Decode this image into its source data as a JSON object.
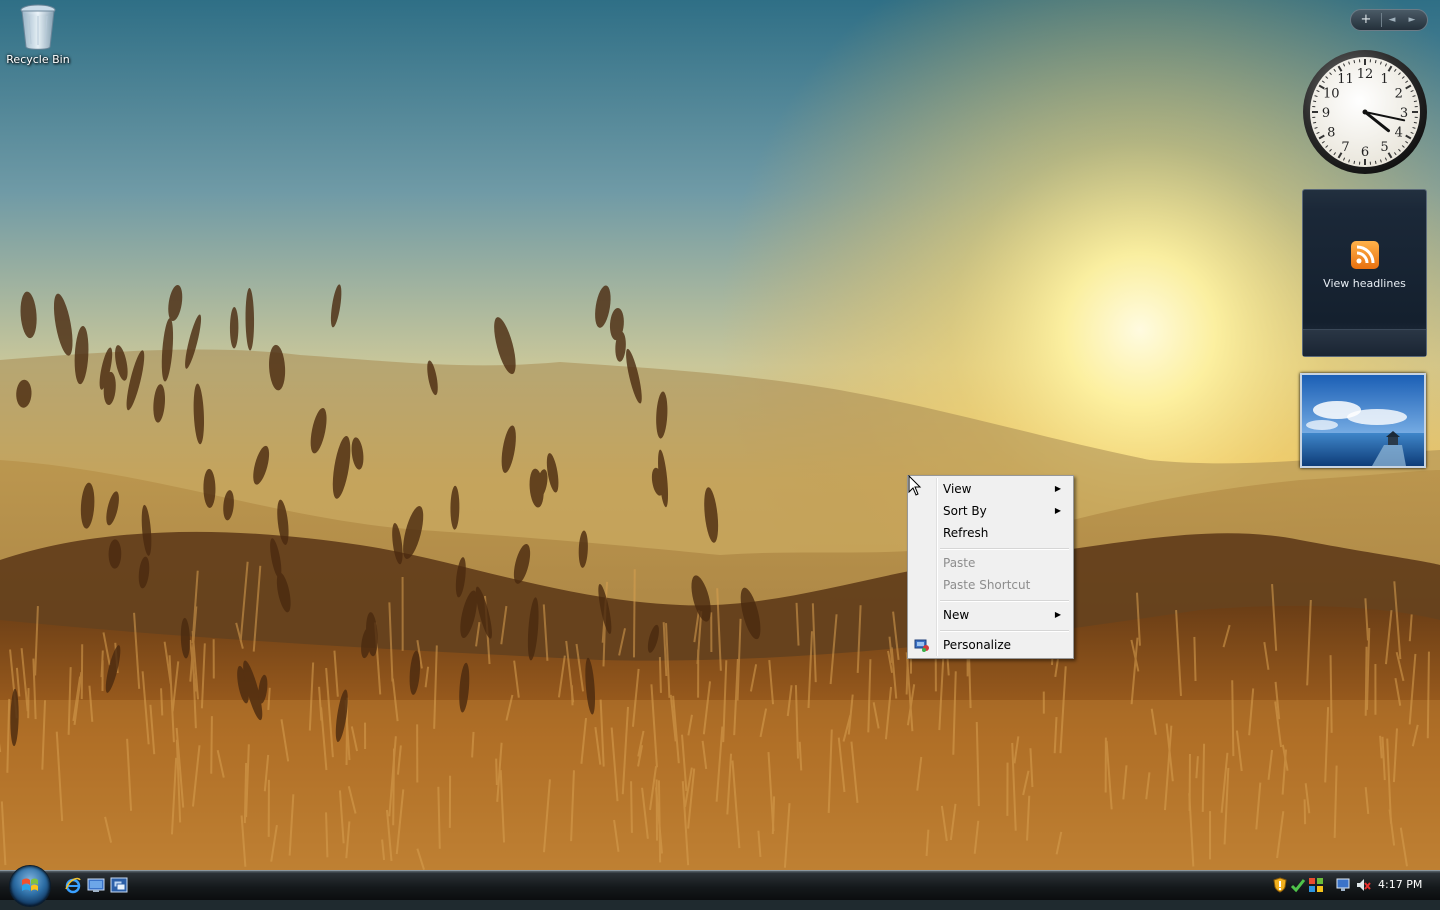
{
  "desktop": {
    "icons": [
      {
        "label": "Recycle Bin"
      }
    ]
  },
  "sidebar": {
    "controls": {
      "add": "+",
      "prev": "◄",
      "next": "►"
    },
    "clock": {
      "hour": 4,
      "minute": 17
    },
    "feed": {
      "label": "View headlines",
      "icon": "rss-icon"
    },
    "slideshow": {
      "icon": "slideshow-picture"
    }
  },
  "context_menu": {
    "items": [
      {
        "label": "View",
        "submenu": true,
        "enabled": true
      },
      {
        "label": "Sort By",
        "submenu": true,
        "enabled": true
      },
      {
        "label": "Refresh",
        "submenu": false,
        "enabled": true
      },
      {
        "label": "Paste",
        "submenu": false,
        "enabled": false
      },
      {
        "label": "Paste Shortcut",
        "submenu": false,
        "enabled": false
      },
      {
        "label": "New",
        "submenu": true,
        "enabled": true
      },
      {
        "label": "Personalize",
        "submenu": false,
        "enabled": true,
        "icon": "personalize-icon"
      }
    ]
  },
  "taskbar": {
    "start": {
      "icon": "windows-orb-icon"
    },
    "quick_launch": [
      "internet-explorer-icon",
      "show-desktop-icon",
      "switch-windows-icon"
    ],
    "tray_icons": [
      "security-shield-icon",
      "windows-update-icon",
      "network-icon",
      "volume-muted-icon"
    ],
    "clock": "4:17 PM"
  },
  "colors": {
    "taskbar": "#15191c",
    "menu_background": "#f0f0f0",
    "menu_disabled_text": "#8d8d8d"
  }
}
